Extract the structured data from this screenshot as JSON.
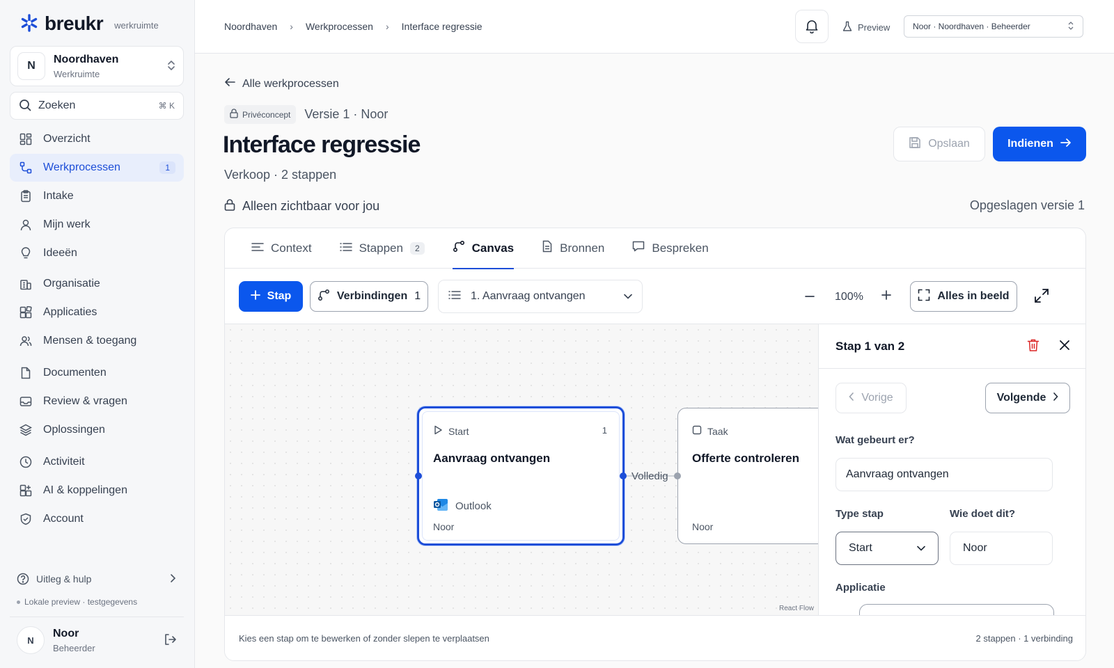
{
  "brand": {
    "name": "breukr",
    "sub": "werkruimte"
  },
  "workspace": {
    "initial": "N",
    "name": "Noordhaven",
    "type": "Werkruimte"
  },
  "search": {
    "placeholder": "Zoeken",
    "shortcut": "⌘ K"
  },
  "nav": [
    {
      "label": "Overzicht",
      "icon": "grid-icon",
      "active": false
    },
    {
      "label": "Werkprocessen",
      "icon": "workflow-icon",
      "active": true,
      "count": "1"
    },
    {
      "label": "Intake",
      "icon": "clipboard-icon"
    },
    {
      "label": "Mijn werk",
      "icon": "user-icon"
    },
    {
      "label": "Ideeën",
      "icon": "lightbulb-icon"
    },
    {
      "label": "Organisatie",
      "icon": "building-icon"
    },
    {
      "label": "Applicaties",
      "icon": "apps-icon"
    },
    {
      "label": "Mensen & toegang",
      "icon": "users-icon"
    },
    {
      "label": "Documenten",
      "icon": "document-icon"
    },
    {
      "label": "Review & vragen",
      "icon": "inbox-icon"
    },
    {
      "label": "Oplossingen",
      "icon": "layers-icon"
    },
    {
      "label": "Activiteit",
      "icon": "clock-icon"
    },
    {
      "label": "AI & koppelingen",
      "icon": "plug-icon"
    },
    {
      "label": "Account",
      "icon": "shield-icon"
    }
  ],
  "help": {
    "label": "Uitleg & hulp"
  },
  "local": "Lokale preview · testgegevens",
  "user": {
    "initial": "N",
    "name": "Noor",
    "role": "Beheerder"
  },
  "breadcrumbs": [
    "Noordhaven",
    "Werkprocessen",
    "Interface regressie"
  ],
  "topbar": {
    "preview": "Preview",
    "role_select": "Noor · Noordhaven · Beheerder"
  },
  "page": {
    "back": "Alle werkprocessen",
    "badge": "Privéconcept",
    "version": "Versie 1 · Noor",
    "title": "Interface regressie",
    "subtitle": "Verkoop · 2 stappen",
    "save": "Opslaan",
    "submit": "Indienen",
    "private": "Alleen zichtbaar voor jou",
    "saved": "Opgeslagen versie 1"
  },
  "tabs": [
    {
      "label": "Context",
      "icon": "text-align-icon"
    },
    {
      "label": "Stappen",
      "icon": "list-icon",
      "count": "2"
    },
    {
      "label": "Canvas",
      "icon": "flow-icon",
      "active": true
    },
    {
      "label": "Bronnen",
      "icon": "file-icon"
    },
    {
      "label": "Bespreken",
      "icon": "chat-icon"
    }
  ],
  "toolbar": {
    "step": "Stap",
    "connections": "Verbindingen",
    "connections_count": "1",
    "step_select": "1. Aanvraag ontvangen",
    "zoom": "100%",
    "fit": "Alles in beeld"
  },
  "nodes": [
    {
      "type": "Start",
      "number": "1",
      "title": "Aanvraag ontvangen",
      "app": "Outlook",
      "owner": "Noor"
    },
    {
      "type": "Taak",
      "title": "Offerte controleren",
      "owner": "Noor"
    }
  ],
  "edge_label": "Volledig",
  "reactflow": "React Flow",
  "panel": {
    "title": "Stap 1 van 2",
    "prev": "Vorige",
    "next": "Volgende",
    "what_label": "Wat gebeurt er?",
    "what_value": "Aanvraag ontvangen",
    "type_label": "Type stap",
    "type_value": "Start",
    "who_label": "Wie doet dit?",
    "who_value": "Noor",
    "app_label": "Applicatie"
  },
  "footer": {
    "hint": "Kies een stap om te bewerken of zonder slepen te verplaatsen",
    "stats": "2 stappen · 1 verbinding"
  },
  "colors": {
    "accent": "#0b57ed",
    "active_bg": "#e8eefc",
    "delete": "#dc2626"
  }
}
